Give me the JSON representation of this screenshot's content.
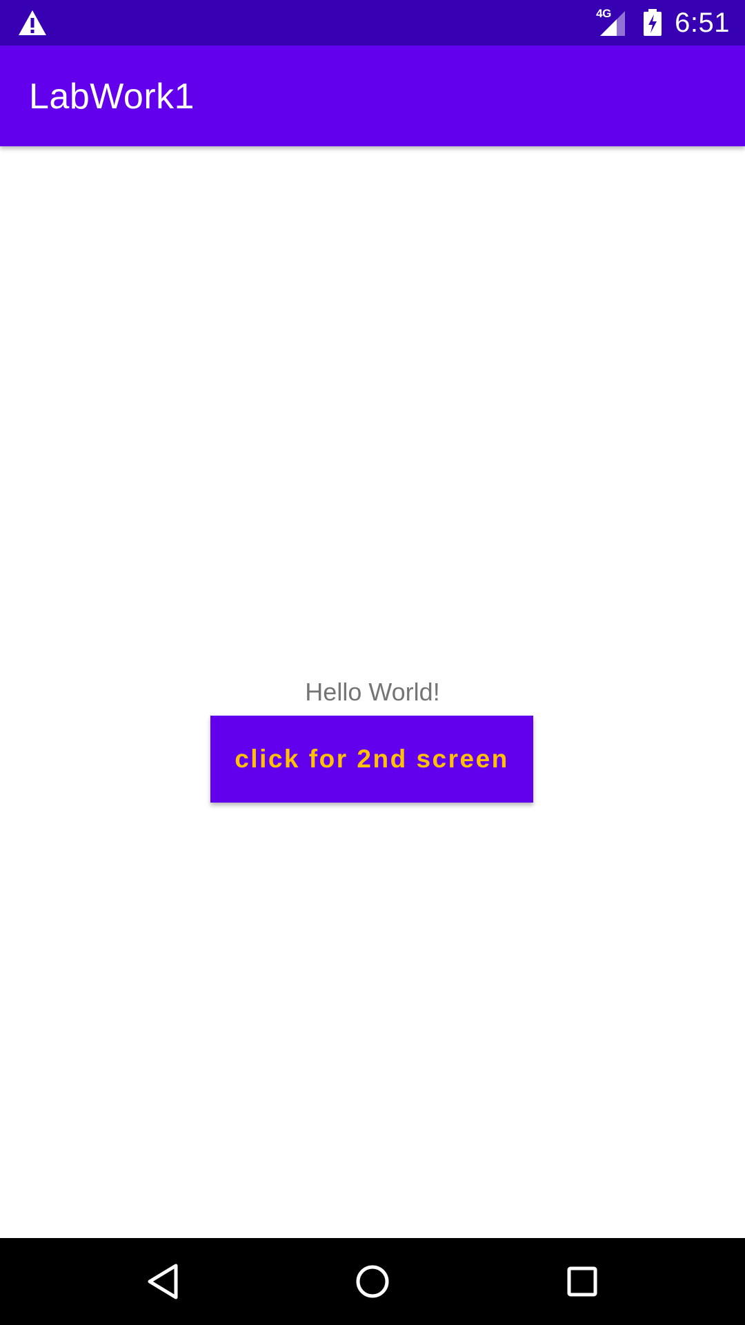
{
  "status_bar": {
    "alert_icon": "warning-triangle-icon",
    "network_label": "4G",
    "signal_icon": "cell-signal-icon",
    "battery_icon": "battery-charging-icon",
    "time": "6:51"
  },
  "app_bar": {
    "title": "LabWork1"
  },
  "main": {
    "greeting": "Hello World!",
    "button_label": "click for 2nd screen"
  },
  "nav_bar": {
    "back_icon": "back-triangle-icon",
    "home_icon": "home-circle-icon",
    "recents_icon": "recents-square-icon"
  },
  "colors": {
    "status_bar": "#3700b3",
    "primary": "#6200ee",
    "button_text": "#ffc107",
    "body_text": "#757575",
    "nav_bar": "#000000"
  }
}
